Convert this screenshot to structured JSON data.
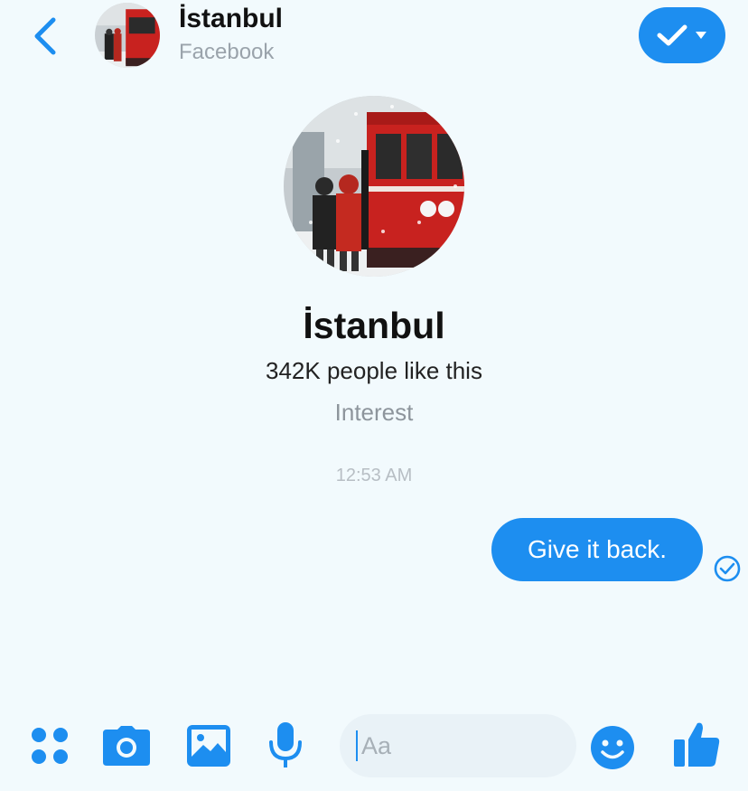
{
  "header": {
    "title": "İstanbul",
    "subtitle": "Facebook",
    "back_icon": "chevron-left-icon",
    "action_icons": [
      "checkmark-icon",
      "caret-down-icon"
    ]
  },
  "profile": {
    "name": "İstanbul",
    "likes": "342K people like this",
    "category": "Interest",
    "avatar_description_icon": "profile-photo"
  },
  "conversation": {
    "timestamp": "12:53 AM",
    "messages": [
      {
        "text": "Give it back.",
        "from": "me",
        "status_icon": "read-check-icon"
      }
    ]
  },
  "composer": {
    "placeholder": "Aa",
    "icons": [
      "more-dots-icon",
      "camera-icon",
      "gallery-icon",
      "microphone-icon",
      "emoji-icon",
      "thumbs-up-icon"
    ]
  },
  "colors": {
    "accent": "#1d8ef0",
    "background": "#f2fafd",
    "muted_text": "#9aa3ab"
  }
}
